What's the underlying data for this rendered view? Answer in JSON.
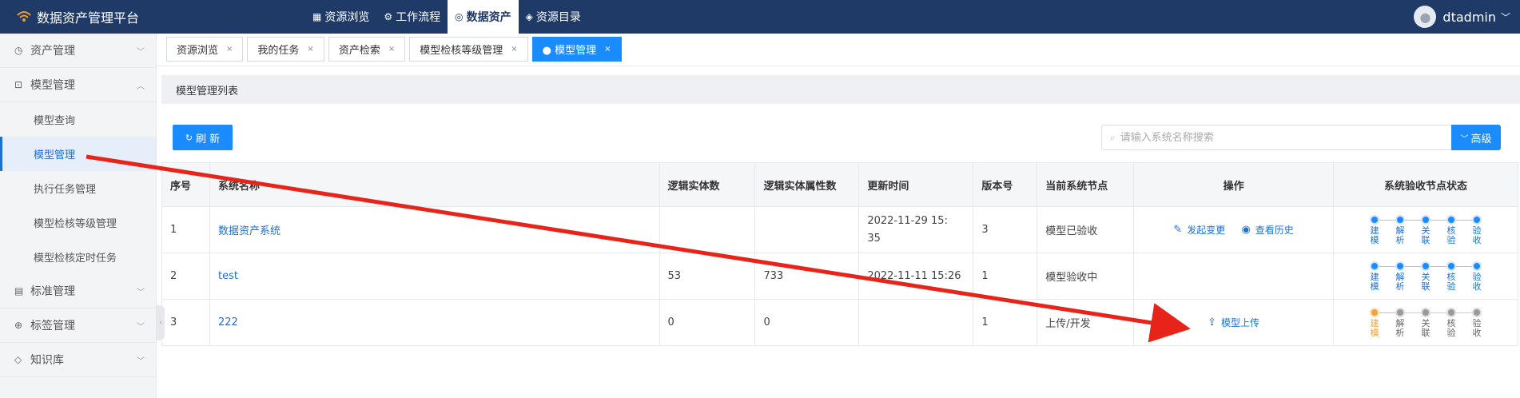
{
  "header": {
    "app_title": "数据资产管理平台",
    "nav": [
      {
        "label": "资源浏览",
        "icon": "grid-icon"
      },
      {
        "label": "工作流程",
        "icon": "workflow-icon"
      },
      {
        "label": "数据资产",
        "icon": "asset-icon",
        "active": true
      },
      {
        "label": "资源目录",
        "icon": "layers-icon"
      }
    ],
    "username": "dtadmin"
  },
  "sidebar": {
    "items": [
      {
        "label": "资产管理",
        "icon": "clock-icon"
      },
      {
        "label": "模型管理",
        "icon": "chart-icon",
        "expanded": true
      },
      {
        "label": "模型查询"
      },
      {
        "label": "模型管理",
        "active": true
      },
      {
        "label": "执行任务管理"
      },
      {
        "label": "模型检核等级管理"
      },
      {
        "label": "模型检核定时任务"
      },
      {
        "label": "标准管理",
        "icon": "doc-icon"
      },
      {
        "label": "标签管理",
        "icon": "plus-circle-icon"
      },
      {
        "label": "知识库",
        "icon": "tag-icon"
      }
    ]
  },
  "tabs": [
    {
      "label": "资源浏览"
    },
    {
      "label": "我的任务"
    },
    {
      "label": "资产检索"
    },
    {
      "label": "模型检核等级管理"
    },
    {
      "label": "● 模型管理",
      "active": true
    }
  ],
  "panel": {
    "title": "模型管理列表"
  },
  "toolbar": {
    "refresh_label": "刷 新",
    "search_placeholder": "请输入系统名称搜索",
    "search_value": "",
    "advanced_label": "高级"
  },
  "table": {
    "headers": [
      "序号",
      "系统名称",
      "逻辑实体数",
      "逻辑实体属性数",
      "更新时间",
      "版本号",
      "当前系统节点",
      "操作",
      "系统验收节点状态"
    ],
    "step_labels": [
      "建模",
      "解析",
      "关联",
      "核验",
      "验收"
    ],
    "rows": [
      {
        "index": "1",
        "name": "数据资产系统",
        "entities": "",
        "attributes": "",
        "updated": "2022-11-29 15:35",
        "version": "3",
        "node": "模型已验收",
        "ops": [
          {
            "label": "发起变更",
            "icon": "edit-icon"
          },
          {
            "label": "查看历史",
            "icon": "eye-icon"
          }
        ],
        "steps": [
          "done",
          "done",
          "done",
          "done",
          "done"
        ]
      },
      {
        "index": "2",
        "name": "test",
        "entities": "53",
        "attributes": "733",
        "updated": "2022-11-11 15:26",
        "version": "1",
        "node": "模型验收中",
        "ops": [],
        "steps": [
          "done",
          "done",
          "done",
          "done",
          "done"
        ]
      },
      {
        "index": "3",
        "name": "222",
        "entities": "0",
        "attributes": "0",
        "updated": "",
        "version": "1",
        "node": "上传/开发",
        "ops": [
          {
            "label": "模型上传",
            "icon": "upload-icon"
          }
        ],
        "steps": [
          "current",
          "pending",
          "pending",
          "pending",
          "pending"
        ]
      }
    ]
  },
  "colors": {
    "topbar": "#1f3a66",
    "primary": "#1a8cff",
    "link": "#1f6fd1",
    "annotation_arrow": "#e8241a",
    "step_current": "#f2a33a",
    "step_pending": "#9a9a9a"
  }
}
